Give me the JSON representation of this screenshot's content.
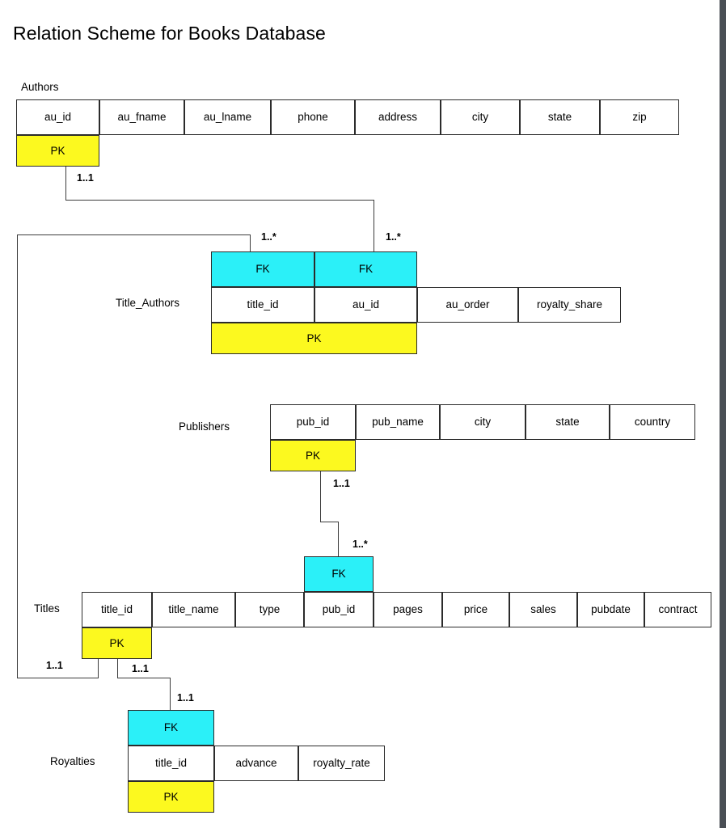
{
  "page": {
    "title": "Relation Scheme for Books Database"
  },
  "colors": {
    "primary_key_fill": "#fcf91f",
    "foreign_key_fill": "#2bf0f8",
    "cell_fill": "#ffffff",
    "border": "#2b2b2b",
    "connector": "#3c3c3c",
    "background": "#ffffff"
  },
  "key_markers": {
    "pk": "PK",
    "fk": "FK"
  },
  "entities": [
    {
      "id": "authors",
      "name": "Authors",
      "attributes": [
        "au_id",
        "au_fname",
        "au_lname",
        "phone",
        "address",
        "city",
        "state",
        "zip"
      ],
      "primary_key": [
        "au_id"
      ],
      "foreign_keys": []
    },
    {
      "id": "title_authors",
      "name": "Title_Authors",
      "attributes": [
        "title_id",
        "au_id",
        "au_order",
        "royalty_share"
      ],
      "primary_key": [
        "title_id",
        "au_id"
      ],
      "foreign_keys": [
        "title_id",
        "au_id"
      ]
    },
    {
      "id": "publishers",
      "name": "Publishers",
      "attributes": [
        "pub_id",
        "pub_name",
        "city",
        "state",
        "country"
      ],
      "primary_key": [
        "pub_id"
      ],
      "foreign_keys": []
    },
    {
      "id": "titles",
      "name": "Titles",
      "attributes": [
        "title_id",
        "title_name",
        "type",
        "pub_id",
        "pages",
        "price",
        "sales",
        "pubdate",
        "contract"
      ],
      "primary_key": [
        "title_id"
      ],
      "foreign_keys": [
        "pub_id"
      ]
    },
    {
      "id": "royalties",
      "name": "Royalties",
      "attributes": [
        "title_id",
        "advance",
        "royalty_rate"
      ],
      "primary_key": [
        "title_id"
      ],
      "foreign_keys": [
        "title_id"
      ]
    }
  ],
  "relationships": [
    {
      "id": "authors-to-title_authors",
      "from_entity": "Authors",
      "from_attribute": "au_id",
      "from_multiplicity": "1..1",
      "to_entity": "Title_Authors",
      "to_attribute": "au_id",
      "to_multiplicity": "1..*"
    },
    {
      "id": "titles-to-title_authors",
      "from_entity": "Titles",
      "from_attribute": "title_id",
      "from_multiplicity": "1..1",
      "to_entity": "Title_Authors",
      "to_attribute": "title_id",
      "to_multiplicity": "1..*"
    },
    {
      "id": "publishers-to-titles",
      "from_entity": "Publishers",
      "from_attribute": "pub_id",
      "from_multiplicity": "1..1",
      "to_entity": "Titles",
      "to_attribute": "pub_id",
      "to_multiplicity": "1..*"
    },
    {
      "id": "titles-to-royalties",
      "from_entity": "Titles",
      "from_attribute": "title_id",
      "from_multiplicity": "1..1",
      "to_entity": "Royalties",
      "to_attribute": "title_id",
      "to_multiplicity": "1..1"
    }
  ],
  "multiplicity_labels": {
    "authors_pk": "1..1",
    "title_authors_fk_title": "1..*",
    "title_authors_fk_author": "1..*",
    "publishers_pk": "1..1",
    "titles_fk_pub": "1..*",
    "titles_pk_left": "1..1",
    "titles_pk_down": "1..1",
    "royalties_fk": "1..1"
  }
}
